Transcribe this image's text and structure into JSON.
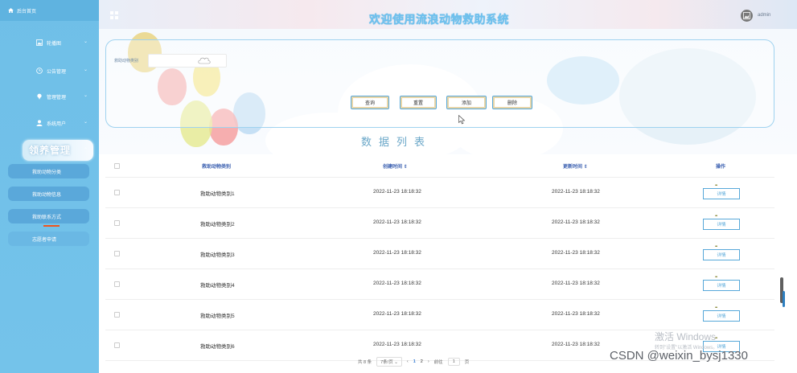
{
  "sidebar": {
    "home_label": "后台首页",
    "menus": [
      {
        "label": "轮播图",
        "icon": "image-icon"
      },
      {
        "label": "公告管理",
        "icon": "clock-icon"
      },
      {
        "label": "管理管理",
        "icon": "pin-icon"
      },
      {
        "label": "系统用户",
        "icon": "user-icon"
      }
    ],
    "active_menu": {
      "label": "领养管理",
      "icon": "grid-icon"
    },
    "submenus": [
      "救助动物分类",
      "救助动物信息",
      "救助联系方式",
      "志愿者申请"
    ]
  },
  "header": {
    "title": "欢迎使用流浪动物救助系统",
    "user": "admin"
  },
  "search": {
    "label": "救助动物类别",
    "value": "",
    "buttons": {
      "query": "查询",
      "reset": "重置",
      "add": "添加",
      "delete": "删除"
    }
  },
  "list_title": "数据列表",
  "table": {
    "headers": {
      "category": "救助动物类别",
      "created": "创建时间 ⇕",
      "updated": "更新时间 ⇕",
      "action": "操作"
    },
    "rows": [
      {
        "category": "救助动物类别1",
        "created": "2022-11-23 18:18:32",
        "updated": "2022-11-23 18:18:32",
        "action": "详情"
      },
      {
        "category": "救助动物类别2",
        "created": "2022-11-23 18:18:32",
        "updated": "2022-11-23 18:18:32",
        "action": "详情"
      },
      {
        "category": "救助动物类别3",
        "created": "2022-11-23 18:18:32",
        "updated": "2022-11-23 18:18:32",
        "action": "详情"
      },
      {
        "category": "救助动物类别4",
        "created": "2022-11-23 18:18:32",
        "updated": "2022-11-23 18:18:32",
        "action": "详情"
      },
      {
        "category": "救助动物类别5",
        "created": "2022-11-23 18:18:32",
        "updated": "2022-11-23 18:18:32",
        "action": "详情"
      },
      {
        "category": "救助动物类别6",
        "created": "2022-11-23 18:18:32",
        "updated": "2022-11-23 18:18:32",
        "action": "详情"
      }
    ]
  },
  "pagination": {
    "total": "共 8 条",
    "page_size": "7条/页",
    "prev": "‹",
    "pages": [
      "1",
      "2"
    ],
    "next": "›",
    "goto_label": "前往",
    "goto_value": "1",
    "goto_suffix": "页"
  },
  "overlay": {
    "activate_line1": "激活 Windows",
    "activate_line2": "转到\"设置\"以激活 Windows。",
    "csdn": "CSDN @weixin_bysj1330"
  },
  "colors": {
    "sidebar": "#6fbfe8",
    "accent": "#57a8d9",
    "title": "#6ec2ef"
  }
}
